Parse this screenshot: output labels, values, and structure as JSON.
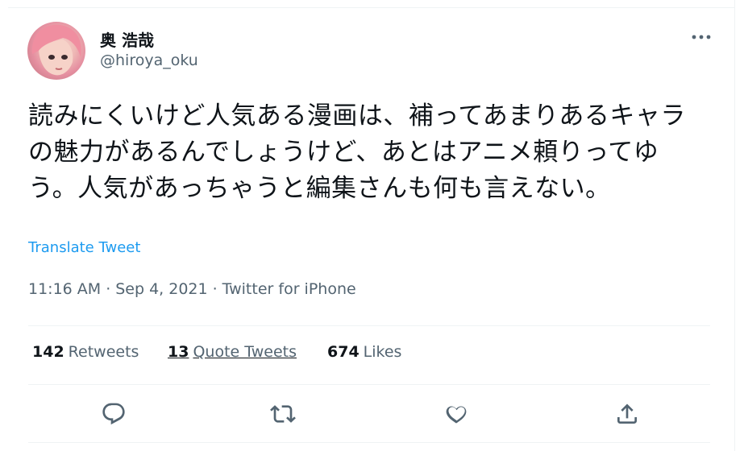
{
  "user": {
    "display_name": "奥 浩哉",
    "handle": "@hiroya_oku"
  },
  "tweet": {
    "text": "読みにくいけど人気ある漫画は、補ってあまりあるキャラの魅力があるんでしょうけど、あとはアニメ頼りってゆう。人気があっちゃうと編集さんも何も言えない。",
    "translate_label": "Translate Tweet",
    "time": "11:16 AM",
    "date": "Sep 4, 2021",
    "separator": "·",
    "source": "Twitter for iPhone"
  },
  "stats": {
    "retweets": {
      "count": "142",
      "label": "Retweets"
    },
    "quote_tweets": {
      "count": "13",
      "label": "Quote Tweets"
    },
    "likes": {
      "count": "674",
      "label": "Likes"
    }
  },
  "icons": {
    "more": "more-horizontal-icon",
    "reply": "reply-icon",
    "retweet": "retweet-icon",
    "like": "heart-icon",
    "share": "share-icon"
  },
  "colors": {
    "text_primary": "#0f1419",
    "text_secondary": "#536471",
    "link": "#1d9bf0",
    "divider": "#eff3f4"
  }
}
